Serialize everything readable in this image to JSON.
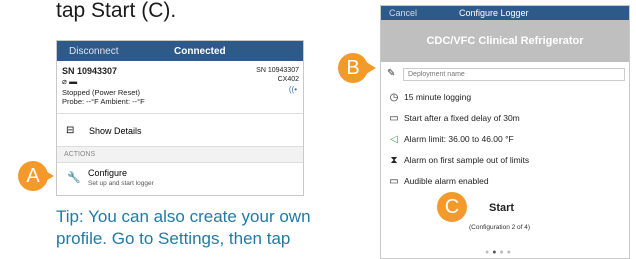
{
  "instruction_text": "tap Start (C).",
  "tip_lines": [
    "Tip: You can also create your own",
    "profile. Go to Settings, then tap"
  ],
  "left_screen": {
    "nav": {
      "disconnect": "Disconnect",
      "title": "Connected"
    },
    "device": {
      "serial": "SN 10943307",
      "serial_right": "SN 10943307",
      "model": "CX402",
      "status": "Stopped (Power Reset)",
      "probe": "Probe: --°F  Ambient: --°F"
    },
    "details_label": "Show Details",
    "actions_header": "ACTIONS",
    "configure": {
      "label": "Configure",
      "sublabel": "Set up and start logger"
    }
  },
  "right_screen": {
    "nav": {
      "cancel": "Cancel",
      "title": "Configure Logger"
    },
    "profile_name": "CDC/VFC Clinical Refrigerator",
    "deployment_placeholder": "Deployment name",
    "settings": [
      {
        "icon": "clock-icon",
        "label": "15 minute logging"
      },
      {
        "icon": "delay-icon",
        "label": "Start after a fixed delay of 30m"
      },
      {
        "icon": "alarm-icon",
        "label": "Alarm limit: 36.00 to 46.00 °F"
      },
      {
        "icon": "hourglass-icon",
        "label": "Alarm on first sample out of limits"
      },
      {
        "icon": "speaker-icon",
        "label": "Audible alarm enabled"
      }
    ],
    "start_label": "Start",
    "config_number": "(Configuration 2 of 4)"
  },
  "markers": {
    "a": "A",
    "b": "B",
    "c": "C"
  },
  "colors": {
    "nav_bar": "#2e5a8a",
    "marker": "#f39a2b",
    "tip_text": "#1f7aa8",
    "banner": "#bfbfbf"
  }
}
